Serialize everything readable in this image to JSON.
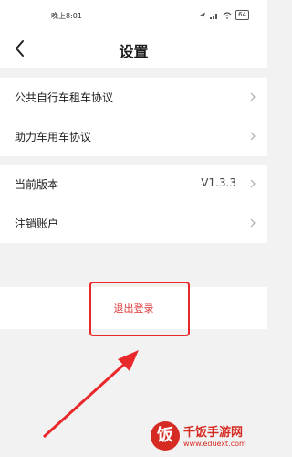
{
  "status_bar": {
    "time": "晚上8:01",
    "battery": "64"
  },
  "header": {
    "title": "设置"
  },
  "group1": {
    "items": [
      {
        "label": "公共自行车租车协议"
      },
      {
        "label": "助力车用车协议"
      }
    ]
  },
  "group2": {
    "items": [
      {
        "label": "当前版本",
        "value": "V1.3.3"
      },
      {
        "label": "注销账户"
      }
    ]
  },
  "logout": {
    "label": "退出登录"
  },
  "watermark": {
    "logo_char": "饭",
    "title": "千饭手游网",
    "url": "www.eduext.com"
  },
  "colors": {
    "accent_red": "#e8282b",
    "logout_text": "#e03a3a",
    "background": "#f2f2f2"
  }
}
